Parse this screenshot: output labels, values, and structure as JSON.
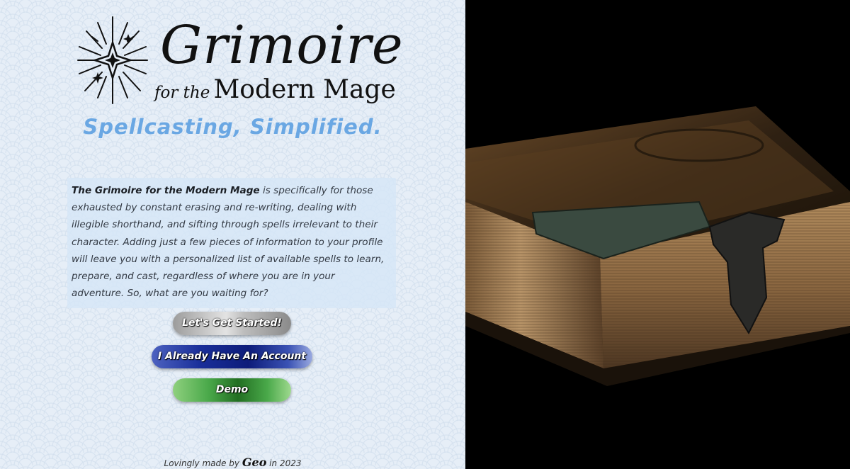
{
  "logo": {
    "title": "Grimoire",
    "sub_small": "for the",
    "sub_big": "Modern Mage",
    "icon": "sparkle-star-icon"
  },
  "tagline": "Spellcasting, Simplified.",
  "intro": {
    "bold": "The Grimoire for the Modern Mage",
    "text": " is specifically for those exhausted by constant erasing and re-writing, dealing with illegible shorthand, and sifting through spells irrelevant to their character. Adding just a few pieces of information to your profile will leave you with a personalized list of available spells to learn, prepare, and cast, regardless of where you are in your adventure. So, what are you waiting for?"
  },
  "buttons": {
    "start": "Let's Get Started!",
    "account": "I Already Have An Account",
    "demo": "Demo"
  },
  "footer": {
    "prefix": "Lovingly made by ",
    "author": "Geo",
    "suffix": " in 2023"
  },
  "colors": {
    "tagline": "#6aa7e3",
    "background": "#e6eef7",
    "account_button": "#1a2f9a",
    "demo_button": "#226f22",
    "start_button": "#bdbdbd"
  }
}
